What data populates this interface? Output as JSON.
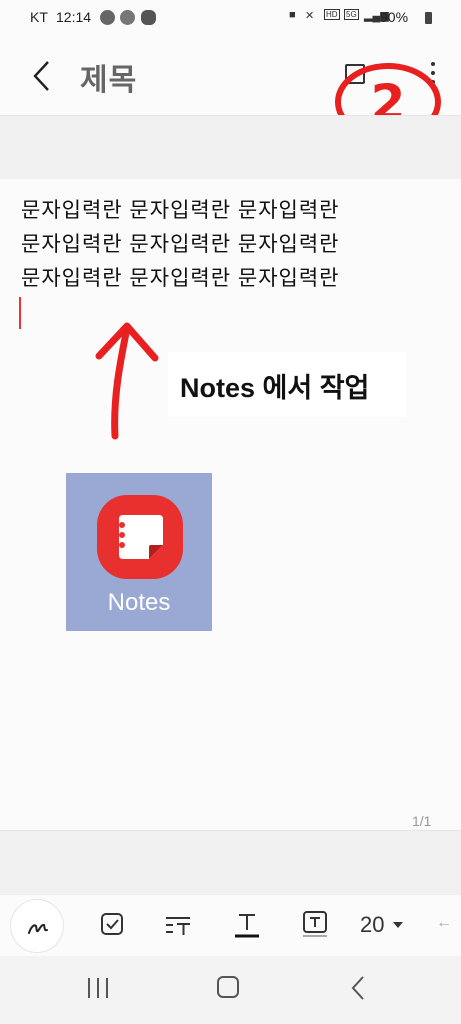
{
  "status_bar": {
    "carrier": "KT",
    "time": "12:14",
    "network": "5G",
    "battery": "90%"
  },
  "header": {
    "title": "제목",
    "annotation": "2"
  },
  "note": {
    "lines": [
      "문자입력란 문자입력란 문자입력란",
      "문자입력란 문자입력란 문자입력란",
      "문자입력란 문자입력란 문자입력란"
    ],
    "annotation_label": "Notes 에서 작업",
    "page_indicator": "1/1"
  },
  "app_tile": {
    "name": "Notes",
    "colors": {
      "tile_bg": "#9aa8d4",
      "icon_red": "#e8302e"
    }
  },
  "toolbar": {
    "font_size": "20",
    "icons": [
      "pen-icon",
      "checkbox-icon",
      "text-style-icon",
      "underline-text-icon",
      "text-box-icon",
      "chevron-down-icon",
      "collapse-arrow-icon"
    ]
  },
  "nav_bar": {
    "icons": [
      "recents-icon",
      "home-icon",
      "back-icon"
    ]
  },
  "colors": {
    "annotation_red": "#e82020",
    "cursor": "#e33333"
  }
}
